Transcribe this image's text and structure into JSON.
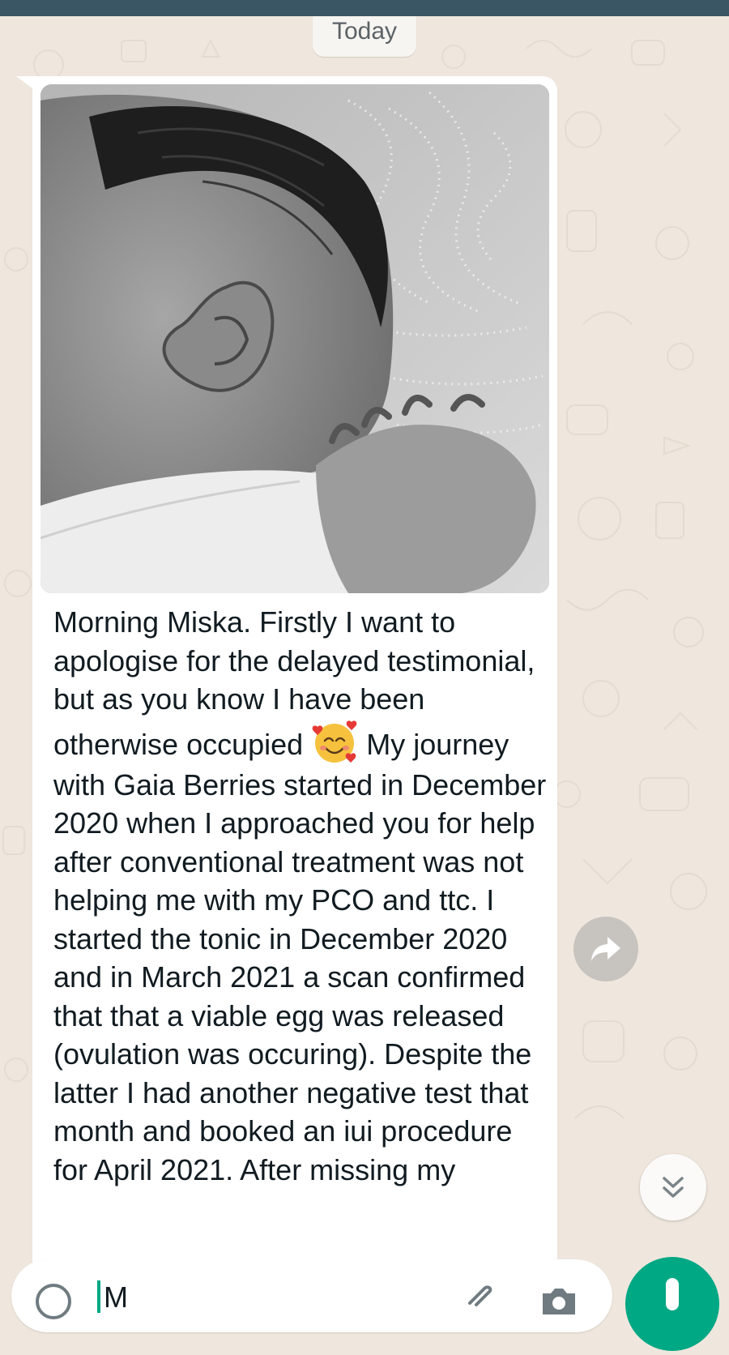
{
  "colors": {
    "status_strip": "#3a5664",
    "wallpaper": "#efe7de",
    "bubble": "#ffffff",
    "accent_green": "#00a884",
    "forward_button": "#c7c3be"
  },
  "chat": {
    "date_separator": "Today"
  },
  "message": {
    "image_icon": "newborn-baby-photo",
    "emoji_icon": "smiling-face-with-hearts-icon",
    "text_part1": "Morning Miska. Firstly I want to apologise for the delayed testimonial, but as you know I have been otherwise occupied",
    "text_part2": "My journey with Gaia Berries started in December 2020 when I approached you for help after conventional treatment was not helping me with my PCO and ttc. I started the tonic in December 2020 and in March 2021 a scan confirmed that that a viable egg was released (ovulation was occuring). Despite the latter I had another negative test that month and booked an iui procedure for April 2021. After missing my"
  },
  "composer": {
    "input_value": "M",
    "icons": [
      "emoji-icon",
      "attach-icon",
      "camera-icon",
      "mic-icon"
    ]
  },
  "floating": {
    "forward_icon": "forward-arrow-icon",
    "scroll_icon": "double-chevron-down-icon"
  }
}
